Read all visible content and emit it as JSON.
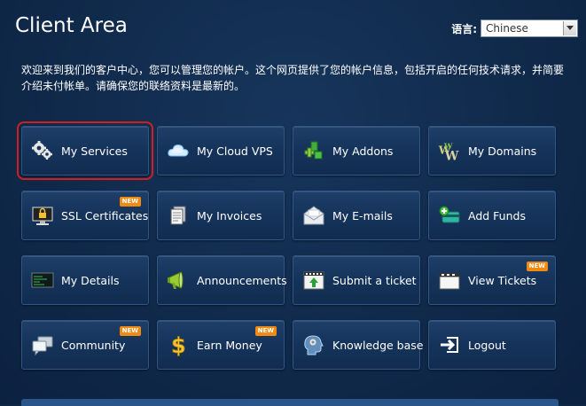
{
  "header": {
    "title": "Client Area",
    "lang_label": "语言:",
    "lang_selected": "Chinese"
  },
  "intro": {
    "text": "欢迎来到我们的客户中心，您可以管理您的帐户。这个网页提供了您的帐户信息，包括开启的任何技术请求，并简要介绍未付帐单。请确保您的联络资料是最新的。"
  },
  "tiles": {
    "my_services": {
      "label": "My Services"
    },
    "my_cloud_vps": {
      "label": "My Cloud VPS"
    },
    "my_addons": {
      "label": "My Addons"
    },
    "my_domains": {
      "label": "My Domains"
    },
    "ssl_certificates": {
      "label": "SSL Certificates",
      "badge": "NEW"
    },
    "my_invoices": {
      "label": "My Invoices"
    },
    "my_emails": {
      "label": "My E-mails"
    },
    "add_funds": {
      "label": "Add Funds"
    },
    "my_details": {
      "label": "My Details"
    },
    "announcements": {
      "label": "Announcements"
    },
    "submit_ticket": {
      "label": "Submit a ticket"
    },
    "view_tickets": {
      "label": "View Tickets",
      "badge": "NEW"
    },
    "community": {
      "label": "Community",
      "badge": "NEW"
    },
    "earn_money": {
      "label": "Earn Money",
      "badge": "NEW"
    },
    "knowledge_base": {
      "label": "Knowledge base"
    },
    "logout": {
      "label": "Logout"
    }
  },
  "colors": {
    "background": "#102a4b",
    "tile": "#15335a",
    "badge": "#f08a12",
    "selected_outline": "#d11f1f"
  }
}
